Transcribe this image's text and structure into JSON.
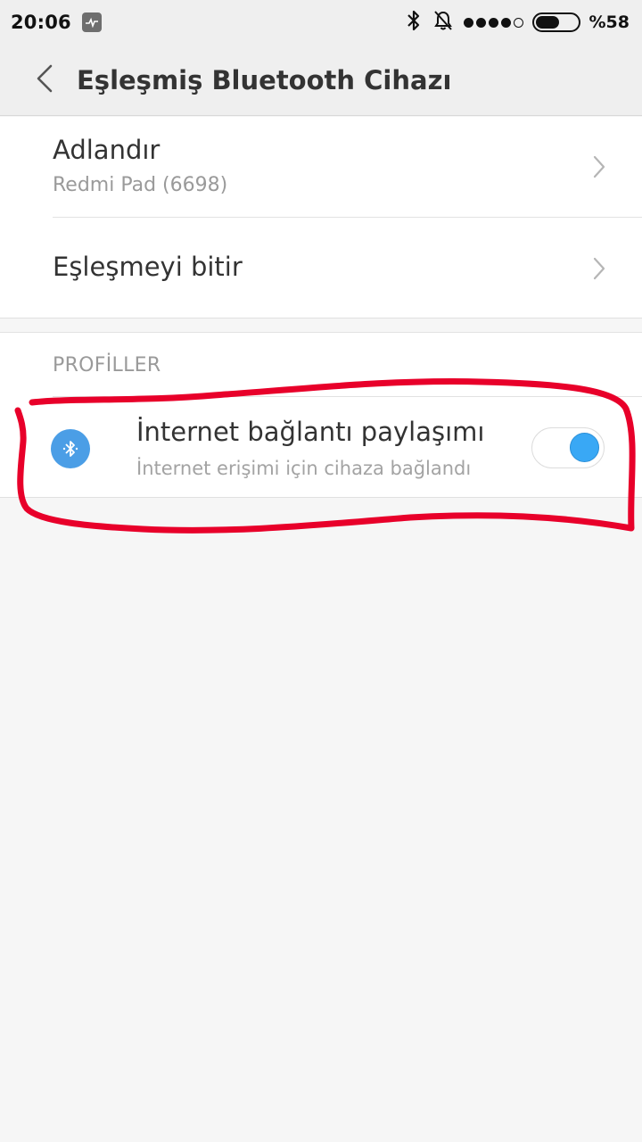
{
  "status_bar": {
    "time": "20:06",
    "battery_percent": "%58",
    "battery_level": 0.58,
    "signal_dots_filled": 4,
    "signal_dots_total": 5,
    "icons": [
      "activity-monitor-icon",
      "bluetooth-icon",
      "bell-off-icon",
      "signal-dots-icon",
      "battery-icon"
    ]
  },
  "header": {
    "title": "Eşleşmiş Bluetooth Cihazı",
    "back_icon": "chevron-left-icon"
  },
  "device_section": {
    "rename": {
      "title": "Adlandır",
      "subtitle": "Redmi Pad (6698)"
    },
    "unpair": {
      "title": "Eşleşmeyi bitir"
    }
  },
  "profiles_section": {
    "label": "PROFİLLER",
    "items": [
      {
        "title": "İnternet bağlantı paylaşımı",
        "subtitle": "İnternet erişimi için cihaza bağlandı",
        "icon": "bluetooth-icon",
        "enabled": true
      }
    ]
  },
  "colors": {
    "accent": "#39a8f5",
    "icon_circle": "#4b9ee6",
    "annotation": "#e8002a"
  }
}
